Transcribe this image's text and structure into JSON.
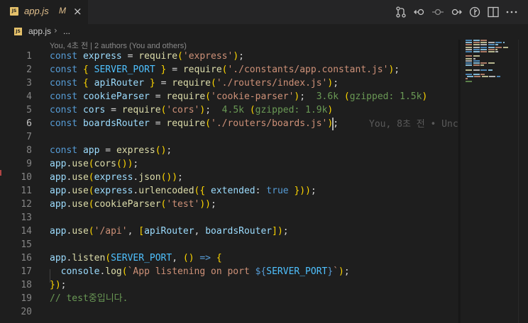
{
  "tab": {
    "badge": "JS",
    "filename": "app.js",
    "modified": "M",
    "close": "×"
  },
  "toolbar_icons": [
    "source-control-icon",
    "go-back-icon",
    "circle-dot-icon",
    "go-forward-icon",
    "timeline-icon",
    "split-editor-icon",
    "more-actions-icon"
  ],
  "breadcrumb": {
    "badge": "JS",
    "file": "app.js",
    "sep": "›",
    "rest": "..."
  },
  "blame": "You, 4초 전 | 2 authors (You and others)",
  "inline_blame": "You, 8초 전 • Unc",
  "lines": [
    {
      "n": "1",
      "t": "const express = require('express');"
    },
    {
      "n": "2",
      "t": "const { SERVER_PORT } = require('./constants/app.constant.js');"
    },
    {
      "n": "3",
      "t": "const { apiRouter } = require('./routers/index.js');"
    },
    {
      "n": "4",
      "t": "const cookieParser = require('cookie-parser');  3.6k (gzipped: 1.5k)"
    },
    {
      "n": "5",
      "t": "const cors = require('cors');  4.5k (gzipped: 1.9k)"
    },
    {
      "n": "6",
      "t": "const boardsRouter = require('./routers/boards.js');"
    },
    {
      "n": "7",
      "t": ""
    },
    {
      "n": "8",
      "t": "const app = express();"
    },
    {
      "n": "9",
      "t": "app.use(cors());"
    },
    {
      "n": "10",
      "t": "app.use(express.json());"
    },
    {
      "n": "11",
      "t": "app.use(express.urlencoded({ extended: true }));"
    },
    {
      "n": "12",
      "t": "app.use(cookieParser('test'));"
    },
    {
      "n": "13",
      "t": ""
    },
    {
      "n": "14",
      "t": "app.use('/api', [apiRouter, boardsRouter]);"
    },
    {
      "n": "15",
      "t": ""
    },
    {
      "n": "16",
      "t": "app.listen(SERVER_PORT, () => {"
    },
    {
      "n": "17",
      "t": "  console.log(`App listening on port ${SERVER_PORT}`);"
    },
    {
      "n": "18",
      "t": "});"
    },
    {
      "n": "19",
      "t": "// test중입니다."
    },
    {
      "n": "20",
      "t": ""
    }
  ],
  "colors": {
    "background": "#1e1e1e",
    "keyword": "#569cd6",
    "string": "#ce9178",
    "function": "#dcdcaa",
    "variable": "#9cdcfe",
    "comment": "#6a9955"
  }
}
